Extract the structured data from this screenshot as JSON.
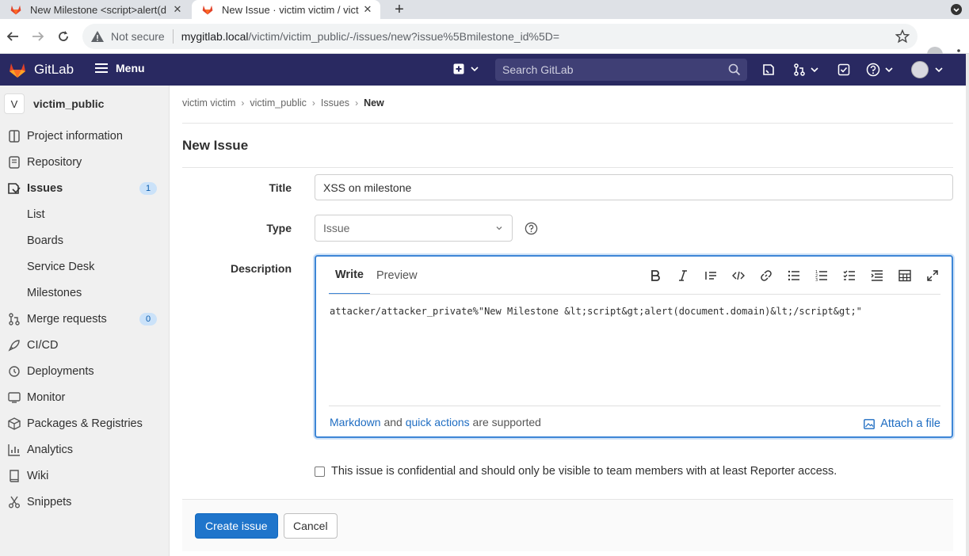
{
  "browser": {
    "tabs": [
      {
        "title": "New Milestone <script>alert(d"
      },
      {
        "title": "New Issue · victim victim / vict"
      }
    ],
    "security_label": "Not secure",
    "url_host": "mygitlab.local",
    "url_path": "/victim/victim_public/-/issues/new?issue%5Bmilestone_id%5D="
  },
  "header": {
    "app_name": "GitLab",
    "menu_label": "Menu",
    "search_placeholder": "Search GitLab"
  },
  "sidebar": {
    "project_avatar": "V",
    "project_name": "victim_public",
    "items": [
      {
        "label": "Project information",
        "icon": "info-icon"
      },
      {
        "label": "Repository",
        "icon": "doc-icon"
      },
      {
        "label": "Issues",
        "icon": "issues-icon",
        "badge": "1"
      },
      {
        "label": "List"
      },
      {
        "label": "Boards"
      },
      {
        "label": "Service Desk"
      },
      {
        "label": "Milestones"
      },
      {
        "label": "Merge requests",
        "icon": "merge-request-icon",
        "badge": "0"
      },
      {
        "label": "CI/CD",
        "icon": "rocket-icon"
      },
      {
        "label": "Deployments",
        "icon": "deployments-icon"
      },
      {
        "label": "Monitor",
        "icon": "monitor-icon"
      },
      {
        "label": "Packages & Registries",
        "icon": "package-icon"
      },
      {
        "label": "Analytics",
        "icon": "chart-icon"
      },
      {
        "label": "Wiki",
        "icon": "book-icon"
      },
      {
        "label": "Snippets",
        "icon": "scissors-icon"
      }
    ]
  },
  "breadcrumb": [
    "victim victim",
    "victim_public",
    "Issues",
    "New"
  ],
  "page_title": "New Issue",
  "form": {
    "title_label": "Title",
    "title_value": "XSS on milestone",
    "type_label": "Type",
    "type_value": "Issue",
    "description_label": "Description",
    "write_tab": "Write",
    "preview_tab": "Preview",
    "description_value": "attacker/attacker_private%\"New Milestone &lt;script&gt;alert(document.domain)&lt;/script&gt;\"",
    "markdown_link": "Markdown",
    "and_text": " and ",
    "quick_actions_link": "quick actions",
    "supported_text": " are supported",
    "attach_label": "Attach a file",
    "confidential_label": "This issue is confidential and should only be visible to team members with at least Reporter access.",
    "confidential_checked": false
  },
  "actions": {
    "create_label": "Create issue",
    "cancel_label": "Cancel"
  },
  "colors": {
    "header_bg": "#292961",
    "primary_button": "#1f75cb",
    "link": "#1f6dc2"
  }
}
